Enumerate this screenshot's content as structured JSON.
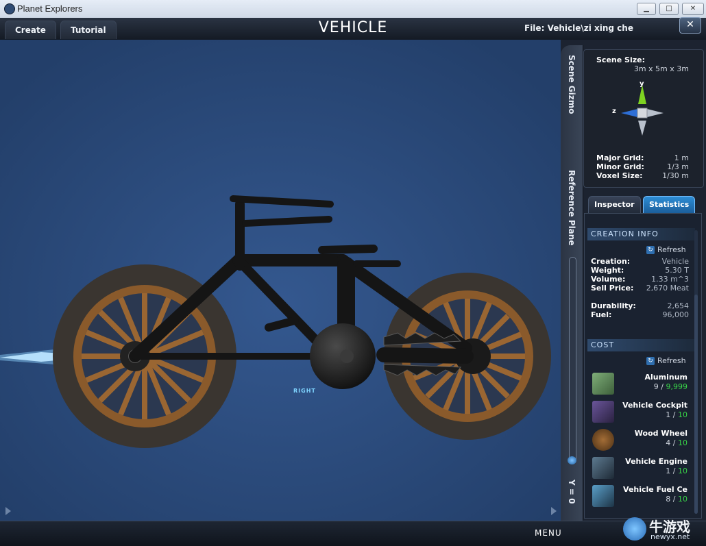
{
  "window": {
    "title": "Planet Explorers",
    "min_label": "▁",
    "max_label": "□",
    "close_label": "✕"
  },
  "header": {
    "tabs": [
      {
        "label": "Create"
      },
      {
        "label": "Tutorial"
      }
    ],
    "title": "VEHICLE",
    "file_label": "File:",
    "file_value": "Vehicle\\zi xing che",
    "close_label": "✕"
  },
  "viewport": {
    "direction_label": "RIGHT"
  },
  "side_labels": {
    "scene_gizmo": "Scene Gizmo",
    "reference_plane": "Reference Plane",
    "y_value": "Y = 0"
  },
  "gizmo": {
    "scene_size_label": "Scene Size:",
    "scene_size_value": "3m x 5m x 3m",
    "axis_y": "y",
    "axis_z": "z",
    "rows": [
      {
        "label": "Major Grid:",
        "value": "1 m"
      },
      {
        "label": "Minor Grid:",
        "value": "1/3 m"
      },
      {
        "label": "Voxel Size:",
        "value": "1/30 m"
      }
    ]
  },
  "inspector_tabs": [
    {
      "label": "Inspector"
    },
    {
      "label": "Statistics"
    }
  ],
  "creation_info": {
    "header": "CREATION INFO",
    "refresh_label": "Refresh",
    "rows": [
      {
        "label": "Creation:",
        "value": "Vehicle"
      },
      {
        "label": "Weight:",
        "value": "5.30 T"
      },
      {
        "label": "Volume:",
        "value": "1.33 m^3"
      },
      {
        "label": "Sell Price:",
        "value": "2,670 Meat"
      },
      {
        "label": "Durability:",
        "value": "2,654"
      },
      {
        "label": "Fuel:",
        "value": "96,000"
      }
    ]
  },
  "cost": {
    "header": "COST",
    "refresh_label": "Refresh",
    "items": [
      {
        "name": "Aluminum",
        "have": "9",
        "sep": " / ",
        "need": "9,999",
        "icon": "aluminum-icon",
        "color": "#5e8c5a"
      },
      {
        "name": "Vehicle Cockpit",
        "have": "1",
        "sep": " / ",
        "need": "10",
        "icon": "vehicle-cockpit-icon",
        "color": "#4a3b6b"
      },
      {
        "name": "Wood Wheel",
        "have": "4",
        "sep": " / ",
        "need": "10",
        "icon": "wood-wheel-icon",
        "color": "#7a5128"
      },
      {
        "name": "Vehicle Engine",
        "have": "1",
        "sep": " / ",
        "need": "10",
        "icon": "vehicle-engine-icon",
        "color": "#3e5466"
      },
      {
        "name": "Vehicle Fuel Ce",
        "have": "8",
        "sep": " / ",
        "need": "10",
        "icon": "vehicle-fuel-cell-icon",
        "color": "#35607a"
      }
    ]
  },
  "bottom": {
    "menu_label": "MENU",
    "watermark_cn": "牛游戏",
    "watermark_en": "newyx.net"
  }
}
